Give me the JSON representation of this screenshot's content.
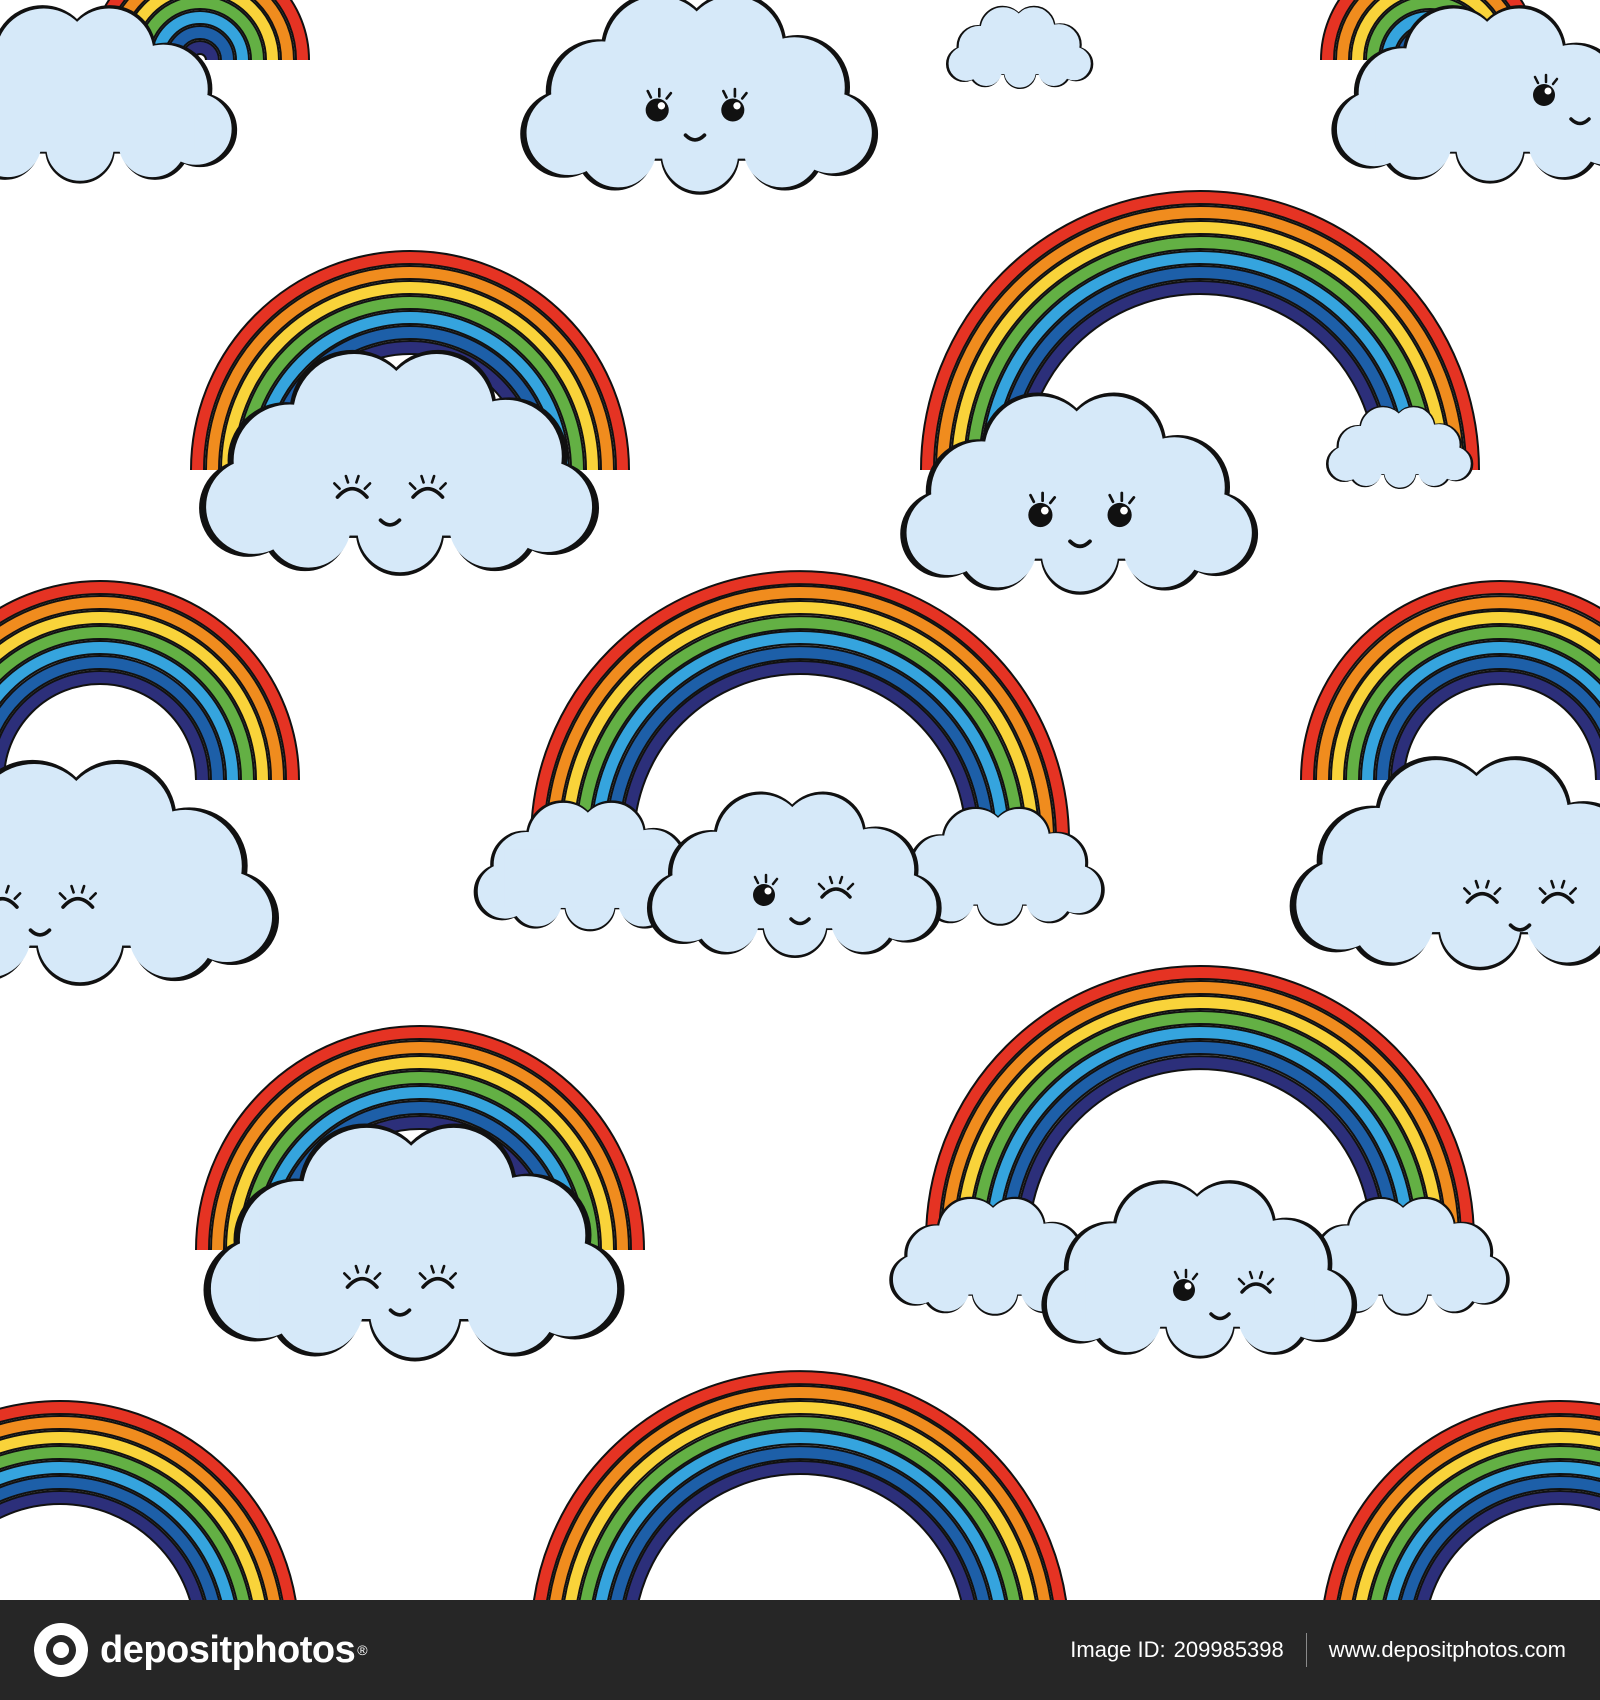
{
  "colors": {
    "background": "#ffffff",
    "footer": "#262626",
    "cloud_fill": "#d6e9f9",
    "outline": "#111111",
    "rainbow": [
      "#e53323",
      "#f08c1e",
      "#f9d33a",
      "#63b044",
      "#35a4de",
      "#1d5fa8",
      "#2c2f7a"
    ]
  },
  "illustration": {
    "subject": "seamless pattern of smiling kawaii clouds with rainbows",
    "icons": [
      "rainbow-icon",
      "cloud-icon",
      "face-icon"
    ]
  },
  "footer": {
    "brand": "depositphotos",
    "registered_mark": "®",
    "image_id_label": "Image ID:",
    "image_id": "209985398",
    "site_url": "www.depositphotos.com"
  }
}
